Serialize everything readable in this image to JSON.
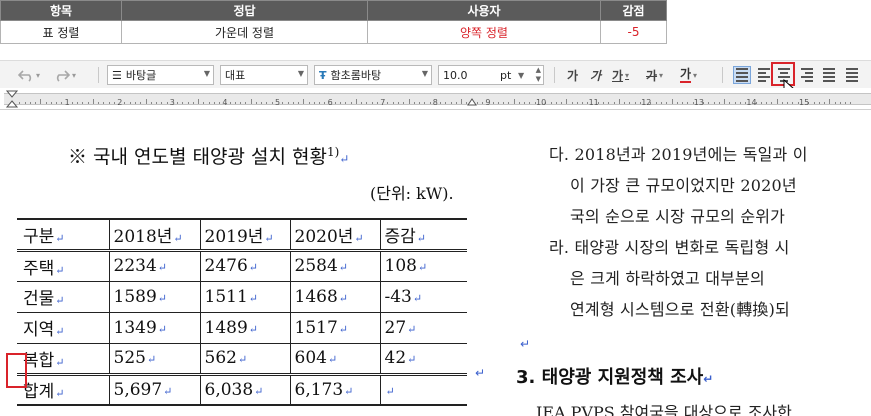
{
  "grading": {
    "headers": [
      "항목",
      "정답",
      "사용자",
      "감점"
    ],
    "row": [
      "표 정렬",
      "가운데 정렬",
      "양쪽 정렬",
      "-5"
    ]
  },
  "toolbar": {
    "undo_icon": "undo-icon",
    "redo_icon": "redo-icon",
    "style_value": "바탕글",
    "style_icon": "paragraph-style-icon",
    "lang_value": "대표",
    "font_value": "함초롬바탕",
    "font_icon": "truetype-font-icon",
    "size_value": "10.0",
    "size_unit": "pt",
    "format_labels": [
      "가",
      "가",
      "가",
      "가",
      "가"
    ],
    "align_active": "distributed",
    "colors": {
      "highlight": "#d9232a",
      "accent": "#3a5fcd"
    }
  },
  "ruler": {
    "numbers": [
      "1",
      "2",
      "3",
      "4",
      "5",
      "6",
      "7",
      "8",
      "9",
      "10",
      "11",
      "12",
      "13",
      "14",
      "15"
    ]
  },
  "document": {
    "title": "※ 국내 연도별 태양광 설치 현황",
    "title_sup": "1)",
    "para_mark": "↵",
    "unit": "(단위: kW).",
    "table": {
      "headers": [
        "구분",
        "2018년",
        "2019년",
        "2020년",
        "증감"
      ],
      "rows": [
        [
          "주택",
          "2234",
          "2476",
          "2584",
          "108"
        ],
        [
          "건물",
          "1589",
          "1511",
          "1468",
          "-43"
        ],
        [
          "지역",
          "1349",
          "1489",
          "1517",
          "27"
        ],
        [
          "복합",
          "525",
          "562",
          "604",
          "42"
        ],
        [
          "합계",
          "5,697",
          "6,038",
          "6,173",
          ""
        ]
      ]
    },
    "right_lines": [
      "다. 2018년과 2019년에는 독일과 이",
      "이 가장 큰 규모이었지만 2020년",
      "국의 순으로 시장 규모의 순위가",
      "라. 태양광 시장의 변화로 독립형 시",
      "은 크게 하락하였고 대부분의 ",
      "연계형 시스템으로 전환(轉換)되"
    ],
    "section_heading": "3. 태양광 지원정책 조사",
    "cut_line": "IEA PVPS 참여국을 대상으로 조사한"
  }
}
